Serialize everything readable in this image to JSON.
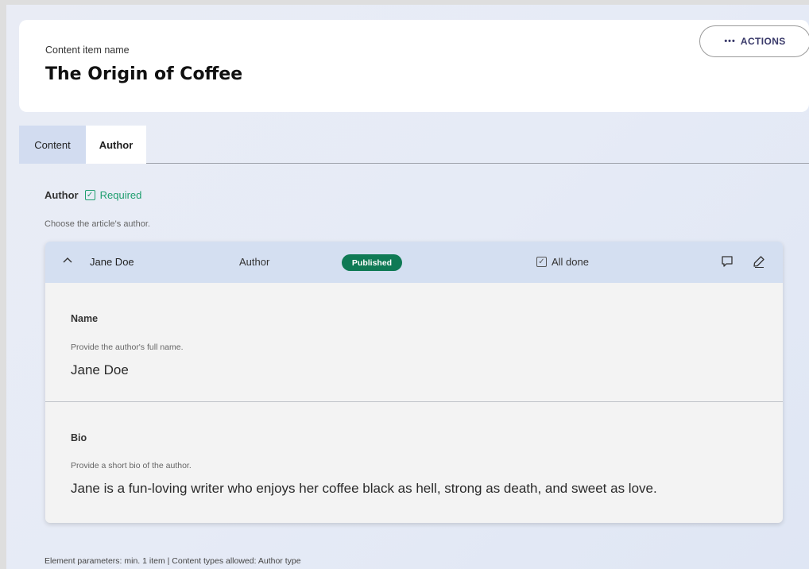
{
  "header": {
    "label": "Content item name",
    "title": "The Origin of Coffee",
    "actions_label": "ACTIONS",
    "actions_icon": "dots-icon"
  },
  "tabs": [
    {
      "label": "Content",
      "active": false
    },
    {
      "label": "Author",
      "active": true
    }
  ],
  "element": {
    "label": "Author",
    "required_label": "Required",
    "guidelines": "Choose the article's author.",
    "parameters": "Element parameters: min. 1 item | Content types allowed: Author type"
  },
  "linked_item": {
    "name": "Jane Doe",
    "type": "Author",
    "status_badge": "Published",
    "completion": "All done",
    "icons": [
      "chevron-up-icon",
      "comment-icon",
      "edit-icon"
    ],
    "fields": [
      {
        "label": "Name",
        "guidelines": "Provide the author's full name.",
        "value": "Jane Doe"
      },
      {
        "label": "Bio",
        "guidelines": "Provide a short bio of the author.",
        "value": "Jane is a fun-loving writer who enjoys her coffee black as hell, strong as death, and sweet as love."
      }
    ]
  },
  "colors": {
    "accent_green": "#1e9e6e",
    "badge_green": "#0f7a55",
    "bar_blue": "#d4dff1",
    "tab_inactive": "#d2dcf0"
  }
}
